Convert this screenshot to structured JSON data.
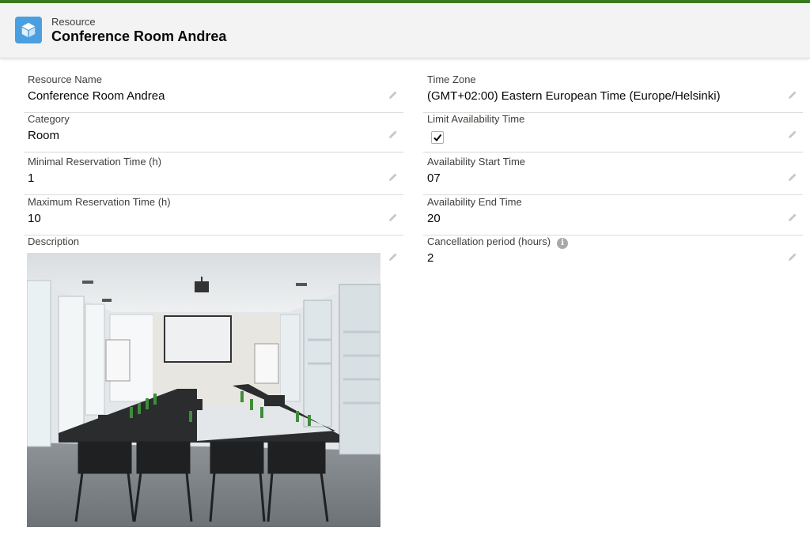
{
  "header": {
    "object_label": "Resource",
    "record_title": "Conference Room Andrea",
    "accent_color": "#3a7a1f",
    "icon": "cube-icon"
  },
  "fields_left": [
    {
      "label": "Resource Name",
      "value": "Conference Room Andrea"
    },
    {
      "label": "Category",
      "value": "Room"
    },
    {
      "label": "Minimal Reservation Time (h)",
      "value": "1"
    },
    {
      "label": "Maximum Reservation Time (h)",
      "value": "10"
    },
    {
      "label": "Description",
      "value": ""
    }
  ],
  "fields_right": [
    {
      "label": "Time Zone",
      "value": "(GMT+02:00) Eastern European Time (Europe/Helsinki)"
    },
    {
      "label": "Limit Availability Time",
      "checked": true
    },
    {
      "label": "Availability Start Time",
      "value": "07"
    },
    {
      "label": "Availability End Time",
      "value": "20"
    },
    {
      "label": "Cancellation period (hours)",
      "value": "2",
      "info_icon": "info-icon"
    }
  ],
  "description_image": "conference-room-photo"
}
